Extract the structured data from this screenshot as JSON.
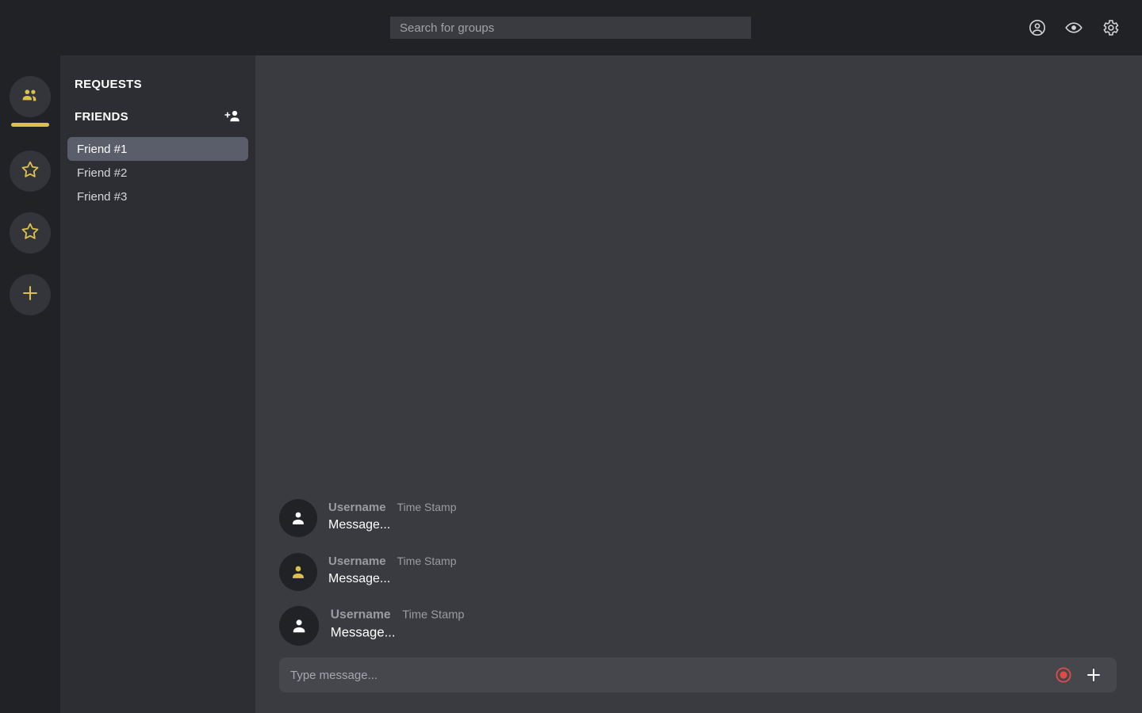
{
  "theme": {
    "accent": "#dcc04e",
    "rail_bg": "#212226",
    "panel_bg": "#2c2e33",
    "chat_bg": "#393b40",
    "selected_row_bg": "#5a5e6a",
    "record_red": "#e14b46"
  },
  "topbar": {
    "search": {
      "placeholder": "Search for groups",
      "value": ""
    },
    "icons": [
      {
        "name": "account-circle-icon",
        "label": "Account"
      },
      {
        "name": "eye-icon",
        "label": "Visibility"
      },
      {
        "name": "gear-icon",
        "label": "Settings"
      }
    ]
  },
  "rail": {
    "items": [
      {
        "icon": "people-group-icon",
        "label": "Friends",
        "active": true
      },
      {
        "icon": "star-outline-icon",
        "label": "Favorites",
        "active": false
      },
      {
        "icon": "star-outline-icon",
        "label": "Favorites",
        "active": false
      },
      {
        "icon": "plus-icon",
        "label": "Add",
        "active": false
      }
    ]
  },
  "sidebar": {
    "requests_label": "REQUESTS",
    "friends_label": "FRIENDS",
    "add_friend_icon": "person-add-icon",
    "friends": [
      {
        "name": "Friend #1",
        "selected": true
      },
      {
        "name": "Friend #2",
        "selected": false
      },
      {
        "name": "Friend #3",
        "selected": false
      }
    ]
  },
  "chat": {
    "messages": [
      {
        "username": "Username",
        "timestamp": "Time Stamp",
        "text": "Message...",
        "avatar_color": "#ffffff",
        "hovered": false
      },
      {
        "username": "Username",
        "timestamp": "Time Stamp",
        "text": "Message...",
        "avatar_color": "#dcc04e",
        "hovered": false
      },
      {
        "username": "Username",
        "timestamp": "Time Stamp",
        "text": "Message...",
        "avatar_color": "#ffffff",
        "hovered": true
      }
    ],
    "composer": {
      "placeholder": "Type message...",
      "value": "",
      "record_icon": "record-button-icon",
      "add_icon": "plus-icon"
    }
  }
}
